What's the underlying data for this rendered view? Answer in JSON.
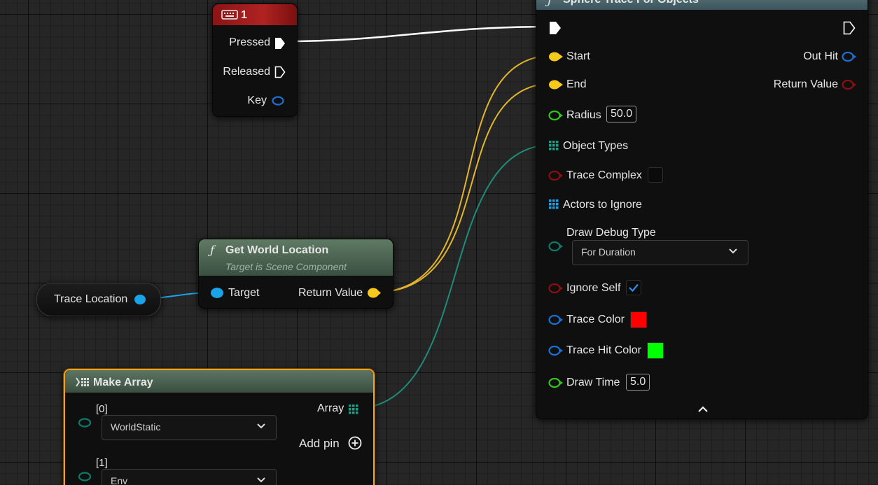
{
  "key_event": {
    "title": "1",
    "pins": {
      "pressed": "Pressed",
      "released": "Released",
      "key": "Key"
    }
  },
  "trace_location": {
    "label": "Trace Location"
  },
  "get_world_location": {
    "title": "Get World Location",
    "subtitle": "Target is Scene Component",
    "target": "Target",
    "return_value": "Return Value"
  },
  "make_array": {
    "title": "Make Array",
    "array_pin": "Array",
    "add_pin": "Add pin",
    "elements": [
      {
        "index": "[0]",
        "value": "WorldStatic"
      },
      {
        "index": "[1]",
        "value": "Env"
      }
    ]
  },
  "sphere_trace": {
    "title": "Sphere Trace For Objects",
    "start": "Start",
    "end": "End",
    "out_hit": "Out Hit",
    "return_value": "Return Value",
    "radius": {
      "label": "Radius",
      "value": "50.0"
    },
    "object_types": "Object Types",
    "trace_complex": "Trace Complex",
    "actors_to_ignore": "Actors to Ignore",
    "draw_debug_type": {
      "label": "Draw Debug Type",
      "value": "For Duration"
    },
    "ignore_self": "Ignore Self",
    "trace_color": {
      "label": "Trace Color",
      "color": "#ff0000"
    },
    "trace_hit_color": {
      "label": "Trace Hit Color",
      "color": "#00ff00"
    },
    "draw_time": {
      "label": "Draw Time",
      "value": "5.0"
    }
  },
  "colors": {
    "exec": "#ffffff",
    "vector_pin": "#f7c81e",
    "object_pin": "#1aa3e8",
    "struct_pin": "#1c6fd3",
    "bool_pin": "#8b0f0f",
    "float_pin": "#36c21f",
    "array_pin": "#1e9e86",
    "byte_pin": "#0f7a6a",
    "event_header": "#8a1414",
    "function_header": "#4a6a52"
  }
}
